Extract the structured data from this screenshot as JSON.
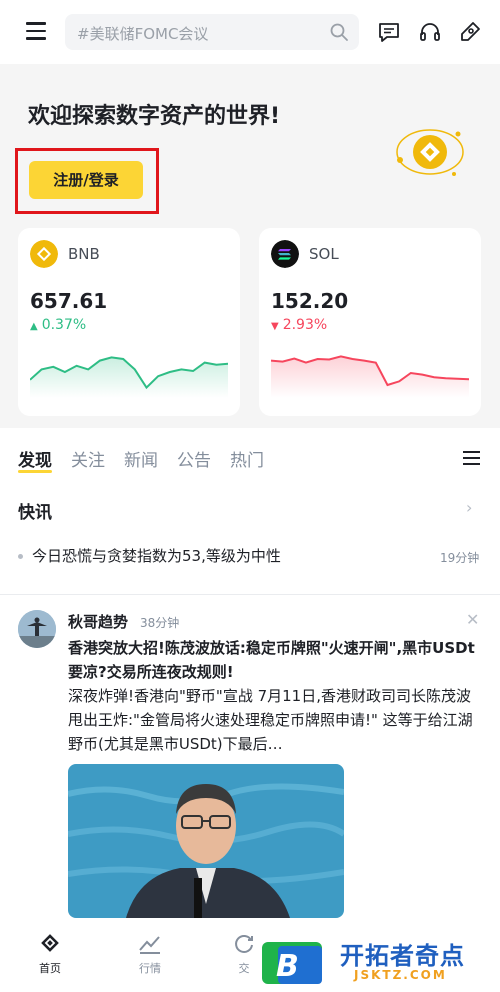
{
  "header": {
    "search_placeholder": "#美联储FOMC会议"
  },
  "hero": {
    "welcome": "欢迎探索数字资产的世界!",
    "login_button": "注册/登录"
  },
  "market_cards": [
    {
      "symbol": "BNB",
      "price": "657.61",
      "change": "0.37%",
      "direction": "up",
      "color": "#2ebd85",
      "sparkline": [
        0.35,
        0.55,
        0.6,
        0.5,
        0.62,
        0.55,
        0.72,
        0.78,
        0.75,
        0.55,
        0.2,
        0.42,
        0.5,
        0.55,
        0.52,
        0.68,
        0.64,
        0.66
      ]
    },
    {
      "symbol": "SOL",
      "price": "152.20",
      "change": "2.93%",
      "direction": "down",
      "color": "#f6465d",
      "sparkline": [
        0.72,
        0.7,
        0.76,
        0.68,
        0.75,
        0.74,
        0.8,
        0.75,
        0.72,
        0.68,
        0.25,
        0.32,
        0.48,
        0.45,
        0.4,
        0.38,
        0.37,
        0.36
      ]
    }
  ],
  "tabs": [
    "发现",
    "关注",
    "新闻",
    "公告",
    "热门"
  ],
  "flash": {
    "title": "快讯",
    "item_text": "今日恐慌与贪婪指数为53,等级为中性",
    "item_time": "19分钟"
  },
  "post": {
    "author": "秋哥趋势",
    "time": "38分钟",
    "headline": "香港突放大招!陈茂波放话:稳定币牌照\"火速开闸\",黑市USDt要凉?交易所连夜改规则!",
    "body": "深夜炸弹!香港向\"野币\"宣战 7月11日,香港财政司司长陈茂波甩出王炸:\"金管局将火速处理稳定币牌照申请!\" 这等于给江湖野币(尤其是黑市USDt)下最后…"
  },
  "bottom_nav": [
    {
      "label": "首页",
      "icon": "home-icon",
      "active": true
    },
    {
      "label": "行情",
      "icon": "markets-icon",
      "active": false
    },
    {
      "label": "交",
      "icon": "trade-icon",
      "active": false
    }
  ],
  "watermark": {
    "name": "开拓者奇点",
    "domain": "JSKTZ.COM",
    "logo_letter": "B"
  }
}
